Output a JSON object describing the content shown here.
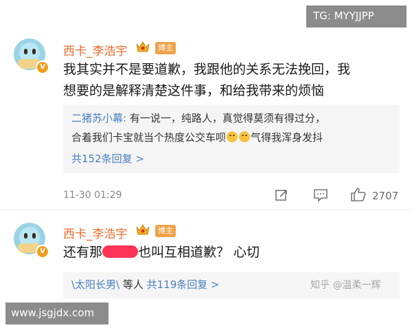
{
  "watermark_top": "TG: MYYJJPP",
  "watermark_bottom": "www.jsgjdx.com",
  "comments": [
    {
      "username": "西卡_李浩宇",
      "host_badge": "博主",
      "v_badge": "V",
      "text_line1": "我其实并不是要道歉，我跟他的关系无法挽回，我",
      "text_line2": "想要的是解释清楚这件事，和给我带来的烦恼",
      "reply": {
        "name": "二猪苏小幕:",
        "line1_text": " 有一说一，纯路人，真觉得莫须有得过分，",
        "line2_text": "合着我们卡宝就当个热度公交车呗",
        "line2_after": "气得我浑身发抖",
        "more": "共152条回复 >"
      },
      "timestamp": "11-30 01:29",
      "like_count": "2707"
    },
    {
      "username": "西卡_李浩宇",
      "host_badge": "博主",
      "v_badge": "V",
      "text_before": "还有那",
      "text_after": "也叫互相道歉？ 心切",
      "reply_summary": {
        "mention": "\\太阳长男\\",
        "others": " 等人 ",
        "count": "共119条回复 >"
      },
      "zhihu_watermark": "知乎 @温柔一辉"
    }
  ],
  "colors": {
    "username": "#e86b2c",
    "link": "#4a7fbf",
    "badge": "#f0a24a",
    "redaction": "#ff3355"
  }
}
